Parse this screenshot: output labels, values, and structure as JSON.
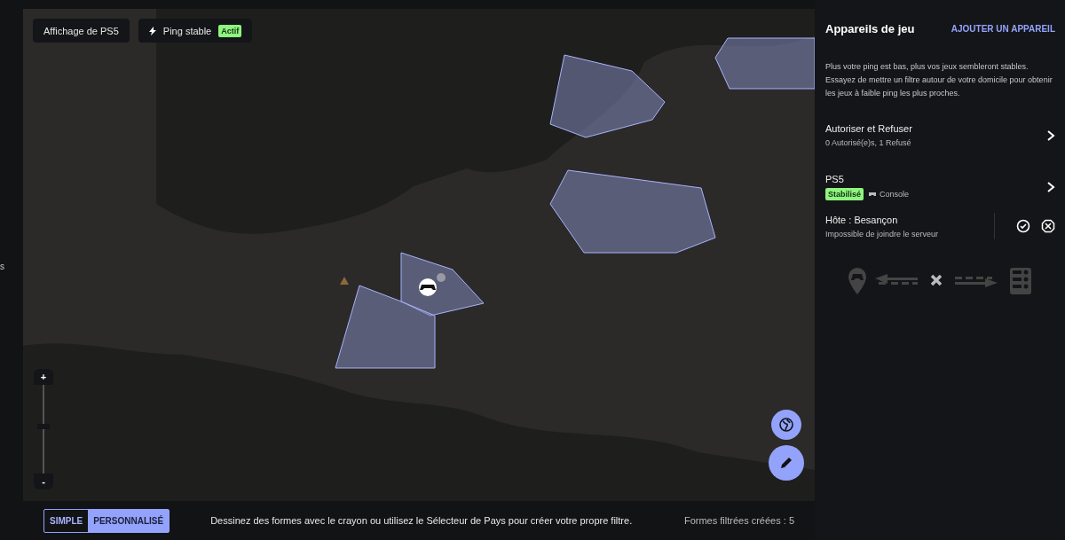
{
  "sidebar": {
    "cut_text": "s"
  },
  "map": {
    "view_label": "Affichage de PS5",
    "ping_chip": {
      "label": "Ping stable",
      "badge": "Actif"
    },
    "zoom": {
      "plus": "+",
      "minus": "-",
      "level": 0.53
    }
  },
  "bottom_bar": {
    "modes": [
      {
        "label": "SIMPLE",
        "selected": false
      },
      {
        "label": "PERSONNALISÉ",
        "selected": true
      }
    ],
    "hint": "Dessinez des formes avec le crayon ou utilisez le Sélecteur de Pays pour créer votre propre filtre.",
    "count": "Formes filtrées créées : 5"
  },
  "panel": {
    "title": "Appareils de jeu",
    "add_link": "AJOUTER UN APPAREIL",
    "description": "Plus votre ping est bas, plus vos jeux sembleront stables. Essayez de mettre un filtre autour de votre domicile pour obtenir les jeux à faible ping les plus proches.",
    "allow_deny": {
      "title": "Autoriser et Refuser",
      "subtitle": "0 Autorisé(e)s, 1 Refusé"
    },
    "device": {
      "name": "PS5",
      "status": "Stabilisé",
      "type": "Console"
    },
    "host": {
      "title": "Hôte : Besançon",
      "subtitle": "Impossible de joindre le serveur"
    }
  }
}
